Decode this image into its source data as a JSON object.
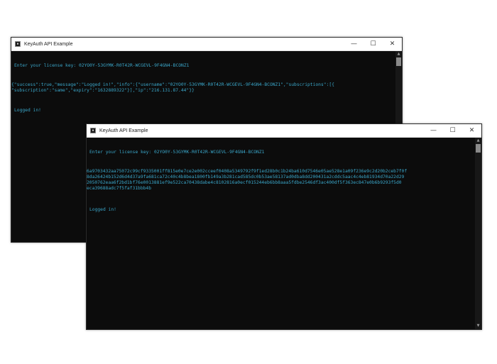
{
  "window_a": {
    "title": "KeyAuth API Example",
    "lines": [
      "Enter your license key: 02YO0Y-53GYMK-R0T42R-WCGEVL-9F4GN4-BCONZ1",
      "{\"success\":true,\"message\":\"Logged in!\",\"info\":{\"username\":\"02YO0Y-53GYMK-R0T42R-WCGEVL-9F4GN4-BCONZ1\",\"subscriptions\":[{",
      "\"subscription\":\"same\",\"expiry\":\"1632889322\"}],\"ip\":\"216.131.87.44\"}}",
      "Logged in!"
    ]
  },
  "window_b": {
    "title": "KeyAuth API Example",
    "lines": [
      "Enter your license key: 02YO0Y-53GYMK-R0T42R-WCGEVL-9F4GN4-BCONZ1",
      "6a9703432aa75072c99cf9335001ff815e0e7ce2e002cceef0408a5349792f9f1ed28b0c1b24ba610d7546e05ae528e1a09f236e9c2d20b2ceb7f0f",
      "8da26424b152d6d4d37a9fa681ca72c40c4b8bea1800fb149a3b281cad585dc0b53ae58137ad0dba8dd200431a2cddc5aac4c4eb81934d70a22d29",
      "2050762eaa6f2bd1bf76e0013881ef9e522ca70438dabe4c8102816a0ecf015244eb6bb8aaa5fdbe2546df3ac400df5f363ec847e0b6b9293f5d0",
      "eca39688adc7f5faf31bbb4b",
      "Logged in!"
    ]
  },
  "controls": {
    "minimize": "—",
    "maximize": "☐",
    "close": "✕"
  },
  "colors": {
    "console_bg": "#0c0c0c",
    "console_text": "#3aa6c9",
    "titlebar_bg": "#ffffff"
  }
}
